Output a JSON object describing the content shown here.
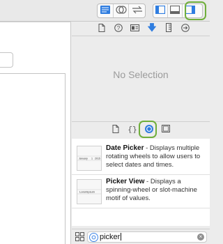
{
  "inspector": {
    "empty_label": "No Selection"
  },
  "library": {
    "items": [
      {
        "title": "Date Picker",
        "description": " - Displays multiple rotating wheels to allow users to select dates and times.",
        "thumb_text_a": "January",
        "thumb_text_b": "1",
        "thumb_text_c": "2015"
      },
      {
        "title": "Picker View",
        "description": " - Displays a spinning-wheel or slot-machine motif of values.",
        "thumb_text": "Loremipsum"
      }
    ],
    "tabs": [
      "file-template-icon",
      "code-snippet-icon",
      "object-library-icon",
      "media-library-icon"
    ],
    "selected_tab": "object-library-icon"
  },
  "filter": {
    "value": "picker"
  },
  "colors": {
    "highlight_ring": "#6fae3b",
    "accent": "#3c84e6"
  }
}
